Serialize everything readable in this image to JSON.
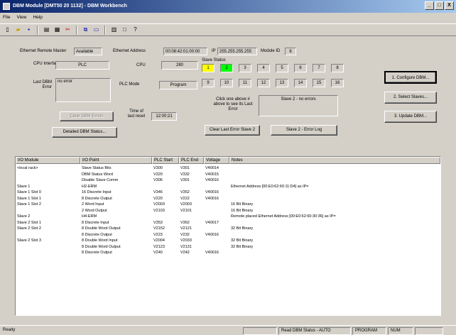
{
  "window": {
    "title": "DBM Module [DMT50 20 1132] - DBM Workbench",
    "minimize": "_",
    "maximize": "□",
    "close": "X"
  },
  "menu": [
    "File",
    "View",
    "Help"
  ],
  "toolbar": {
    "icons": [
      "new-icon",
      "open-icon",
      "save-icon",
      "print-icon",
      "print-preview-icon",
      "cut-icon",
      "copy-icon",
      "paste-icon",
      "print-setup-icon",
      "window-icon",
      "help-icon"
    ],
    "glyphs": [
      "▯",
      "▰",
      "▪",
      "▤",
      "▦",
      "✂",
      "⧉",
      "▭",
      "▥",
      "□",
      "?"
    ]
  },
  "info": {
    "ethernet_master_label": "Ethernet Remote Master",
    "ethernet_master_value": "Available",
    "ethernet_address_label": "Ethernet Address",
    "ethernet_address_value": "00:08:42:01:00:00",
    "ip_label": "IP",
    "ip_value": "255.255.255.255",
    "module_id_label": "Module ID",
    "module_id_value": "6",
    "cpu_interface_label": "CPU Interface",
    "cpu_interface_value": "PLC",
    "cpu_label": "CPU",
    "cpu_value": "280",
    "last_dbm_error_label": "Last DBM Error",
    "last_dbm_error_value": "no error",
    "plc_mode_label": "PLC Mode",
    "plc_mode_value": "Program",
    "time_of_last_reset_label": "Time of last reset",
    "time_of_last_reset_value": "12:00:21",
    "clear_dbm_errors": "Clear DBM Errors",
    "detailed_dbm_status": "Detailed DBM Status..."
  },
  "slave_status": {
    "label": "Slave Status",
    "row1": [
      "1",
      "2",
      "3",
      "4",
      "5",
      "6",
      "7",
      "8"
    ],
    "row2": [
      "9",
      "10",
      "11",
      "12",
      "13",
      "14",
      "15",
      "16"
    ],
    "active_color": "#ffff00",
    "ok_color": "#00ff00",
    "hint": "Click one above # above to see its Last Error",
    "slave_error_text": "Slave 2 - no errors",
    "clear_last_error_button": "Clear Last Error Slave 2",
    "slave_error_log_button": "Slave 2 - Error Log"
  },
  "actions": {
    "configure": "1. Configure DBM...",
    "select_slaves": "2. Select Slaves...",
    "update": "3. Update DBM..."
  },
  "table": {
    "columns": [
      "I/O Module",
      "I/O Point",
      "PLC Start",
      "PLC End",
      "Voltage",
      "Notes"
    ],
    "rows": [
      [
        "<local rack>",
        "Slave Status Bits",
        "V300",
        "V301",
        "V40014",
        ""
      ],
      [
        "",
        "DBM Status Word",
        "V320",
        "V332",
        "V40015",
        ""
      ],
      [
        "",
        "Disable Slave Comm",
        "V306",
        "V301",
        "V40016",
        ""
      ],
      [
        "Slave 1",
        "H2-ERM",
        "",
        "",
        "",
        "Ethernet Address [00:E0:62:60:11:D4] as IP="
      ],
      [
        "Slave 1 Slot 0",
        "16 Discrete Input",
        "V346",
        "V352",
        "V40016",
        ""
      ],
      [
        "Slave 1 Slot 1",
        "8 Discrete Output",
        "V220",
        "V222",
        "V40016",
        ""
      ],
      [
        "Slave 1 Slot 2",
        "2 Word Input",
        "V2003",
        "V2003",
        "",
        "16 Bit Binary"
      ],
      [
        "",
        "2 Word Output",
        "V2103",
        "V2101",
        "",
        "16 Bit Binary"
      ],
      [
        "Slave 2",
        "H4-ERM",
        "",
        "",
        "",
        "Remote placed Ethernet Address [00:E0:62:60:30:36] as IP="
      ],
      [
        "Slave 2 Slot 1",
        "8 Discrete Input",
        "V353",
        "V362",
        "V40017",
        ""
      ],
      [
        "Slave 2 Slot 2",
        "8 Double Word Output",
        "V2152",
        "V2121",
        "",
        "32 Bit Binary"
      ],
      [
        "",
        "8 Discrete Output",
        "V223",
        "V232",
        "V40016",
        ""
      ],
      [
        "Slave 2 Slot 3",
        "8 Double Word Input",
        "V2004",
        "V2033",
        "",
        "32 Bit Binary"
      ],
      [
        "",
        "8 Double Word Output",
        "V2123",
        "V2131",
        "",
        "32 Bit Binary"
      ],
      [
        "",
        "8 Discrete Output",
        "V240",
        "V242",
        "V40016",
        ""
      ]
    ]
  },
  "status": {
    "ready": "Ready",
    "dbm_status": "Read DBM Status - AUTO",
    "mode": "PROGRAM",
    "num": "NUM"
  }
}
